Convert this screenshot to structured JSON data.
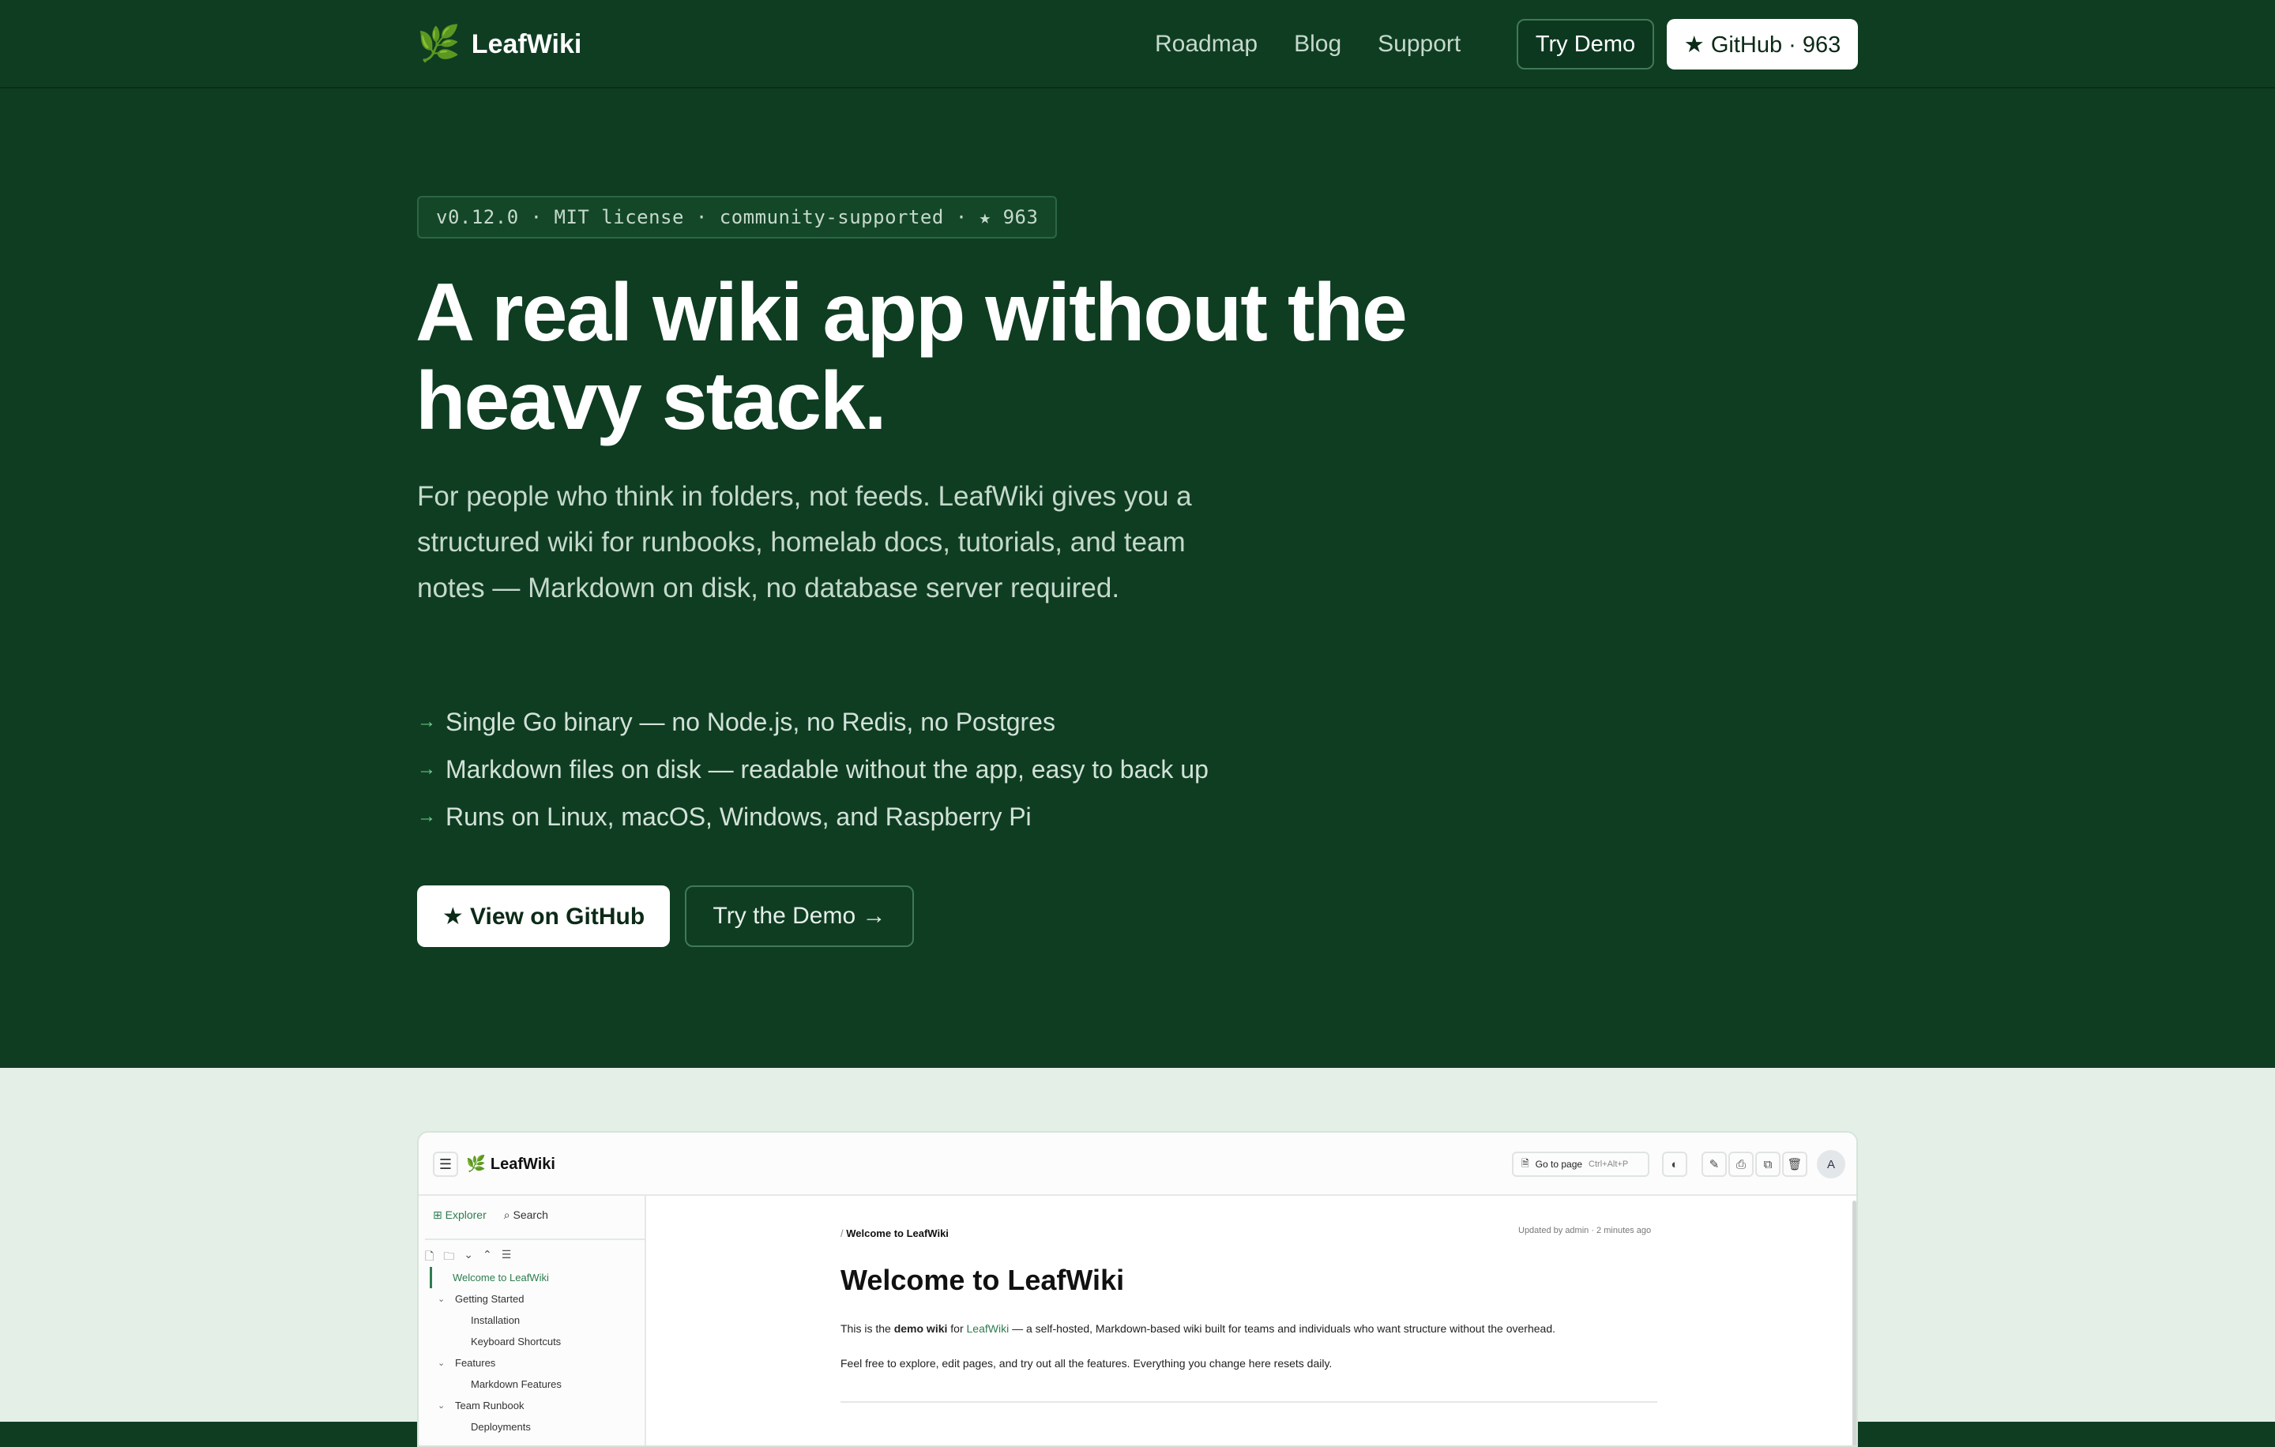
{
  "nav": {
    "brand_icon": "leaf-icon",
    "brand": "LeafWiki",
    "links": [
      "Roadmap",
      "Blog",
      "Support"
    ],
    "try_demo": "Try Demo",
    "github": "★ GitHub · 963"
  },
  "hero": {
    "badge": "v0.12.0 · MIT license · community-supported · ★ 963",
    "title_line1": "A real wiki app without the",
    "title_line2": "heavy stack.",
    "subtitle": "For people who think in folders, not feeds. LeafWiki gives you a structured wiki for runbooks, homelab docs, tutorials, and team notes — Markdown on disk, no database server required.",
    "features": [
      "Single Go binary — no Node.js, no Redis, no Postgres",
      "Markdown files on disk — readable without the app, easy to back up",
      "Runs on Linux, macOS, Windows, and Raspberry Pi"
    ],
    "cta_github": "★ View on GitHub",
    "cta_demo": "Try the Demo →"
  },
  "preview": {
    "app_name": "LeafWiki",
    "goto_label": "Go to page",
    "goto_shortcut": "Ctrl+Alt+P",
    "avatar_initial": "A",
    "sidebar": {
      "tab_explorer": "Explorer",
      "tab_search": "Search",
      "tree": [
        {
          "label": "Welcome to LeafWiki",
          "level": "active"
        },
        {
          "label": "Getting Started",
          "level": "folder"
        },
        {
          "label": "Installation",
          "level": "child"
        },
        {
          "label": "Keyboard Shortcuts",
          "level": "child"
        },
        {
          "label": "Features",
          "level": "folder"
        },
        {
          "label": "Markdown Features",
          "level": "child"
        },
        {
          "label": "Team Runbook",
          "level": "folder"
        },
        {
          "label": "Deployments",
          "level": "child"
        }
      ]
    },
    "doc": {
      "breadcrumb_sep": "/",
      "breadcrumb_page": "Welcome to LeafWiki",
      "updated": "Updated by admin · 2 minutes ago",
      "title": "Welcome to LeafWiki",
      "p1_a": "This is the ",
      "p1_bold": "demo wiki",
      "p1_b": " for ",
      "p1_link": "LeafWiki",
      "p1_c": " — a self-hosted, Markdown-based wiki built for teams and individuals who want structure without the overhead.",
      "p2": "Feel free to explore, edit pages, and try out all the features. Everything you change here resets daily."
    }
  },
  "colors": {
    "hero_bg": "#0f3d22",
    "preview_bg": "#e4f0e7",
    "accent": "#2e7d4f"
  }
}
